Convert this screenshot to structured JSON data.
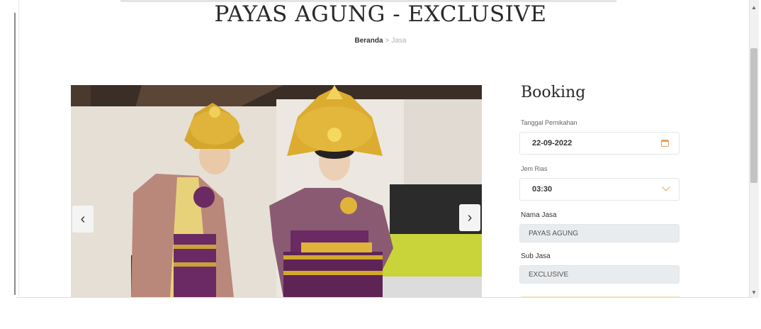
{
  "page": {
    "title": "PAYAS AGUNG - EXCLUSIVE",
    "breadcrumb": {
      "home": "Beranda",
      "separator": ">",
      "current": "Jasa"
    }
  },
  "carousel": {
    "prev_label": "‹",
    "next_label": "›"
  },
  "booking": {
    "title": "Booking",
    "date_label": "Tanggal Pernikahan",
    "date_value": "22-09-2022",
    "time_label": "Jem Rias",
    "time_value": "03:30",
    "service_label": "Nama Jasa",
    "service_value": "PAYAS AGUNG",
    "subservice_label": "Sub Jasa",
    "subservice_value": "EXCLUSIVE"
  },
  "colors": {
    "accent": "#e8a060",
    "readonly_bg": "#e9ecef"
  }
}
